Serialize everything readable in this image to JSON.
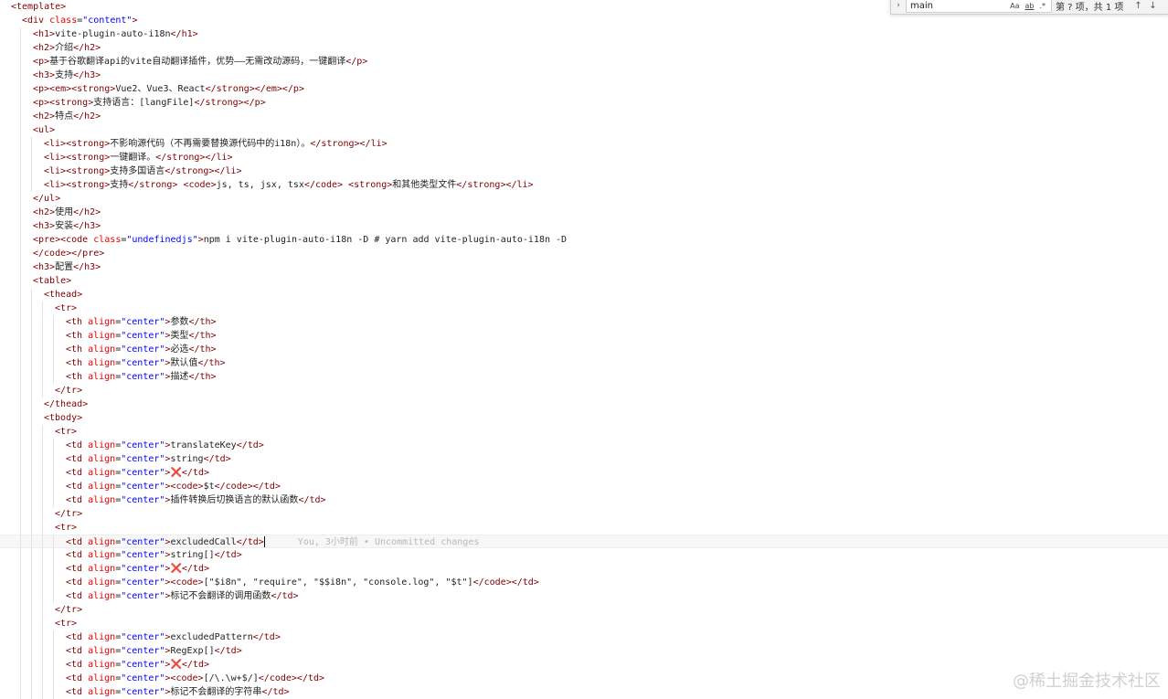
{
  "find_widget": {
    "query": "main",
    "opt_case": "Aa",
    "opt_word": "ab",
    "opt_regex": ".*",
    "result_count": "第 ? 项，共 1 项"
  },
  "blame": "You, 3小时前 • Uncommitted changes",
  "watermark": "@稀土掘金技术社区",
  "lines": [
    {
      "indent": 0,
      "segs": [
        [
          "tag",
          "<template>"
        ]
      ]
    },
    {
      "indent": 1,
      "segs": [
        [
          "tag",
          "<div "
        ],
        [
          "attr",
          "class"
        ],
        [
          "punct",
          "="
        ],
        [
          "str",
          "\"content\""
        ],
        [
          "tag",
          ">"
        ]
      ]
    },
    {
      "indent": 2,
      "segs": [
        [
          "tag",
          "<h1>"
        ],
        [
          "txt",
          "vite-plugin-auto-i18n"
        ],
        [
          "tag",
          "</h1>"
        ]
      ]
    },
    {
      "indent": 2,
      "segs": [
        [
          "tag",
          "<h2>"
        ],
        [
          "txt",
          "介绍"
        ],
        [
          "tag",
          "</h2>"
        ]
      ]
    },
    {
      "indent": 2,
      "segs": [
        [
          "tag",
          "<p>"
        ],
        [
          "txt",
          "基于谷歌翻译api的vite自动翻译插件，优势——无需改动源码，一键翻译"
        ],
        [
          "tag",
          "</p>"
        ]
      ]
    },
    {
      "indent": 2,
      "segs": [
        [
          "tag",
          "<h3>"
        ],
        [
          "txt",
          "支持"
        ],
        [
          "tag",
          "</h3>"
        ]
      ]
    },
    {
      "indent": 2,
      "segs": [
        [
          "tag",
          "<p><em><strong>"
        ],
        [
          "txt",
          "Vue2、Vue3、React"
        ],
        [
          "tag",
          "</strong></em></p>"
        ]
      ]
    },
    {
      "indent": 2,
      "segs": [
        [
          "tag",
          "<p><strong>"
        ],
        [
          "txt",
          "支持语言：[langFile]"
        ],
        [
          "tag",
          "</strong></p>"
        ]
      ]
    },
    {
      "indent": 2,
      "segs": [
        [
          "tag",
          "<h2>"
        ],
        [
          "txt",
          "特点"
        ],
        [
          "tag",
          "</h2>"
        ]
      ]
    },
    {
      "indent": 2,
      "segs": [
        [
          "tag",
          "<ul>"
        ]
      ]
    },
    {
      "indent": 3,
      "segs": [
        [
          "tag",
          "<li><strong>"
        ],
        [
          "txt",
          "不影响源代码（不再需要替换源代码中的i18n）。"
        ],
        [
          "tag",
          "</strong></li>"
        ]
      ]
    },
    {
      "indent": 3,
      "segs": [
        [
          "tag",
          "<li><strong>"
        ],
        [
          "txt",
          "一键翻译。"
        ],
        [
          "tag",
          "</strong></li>"
        ]
      ]
    },
    {
      "indent": 3,
      "segs": [
        [
          "tag",
          "<li><strong>"
        ],
        [
          "txt",
          "支持多国语言"
        ],
        [
          "tag",
          "</strong></li>"
        ]
      ]
    },
    {
      "indent": 3,
      "segs": [
        [
          "tag",
          "<li><strong>"
        ],
        [
          "txt",
          "支持"
        ],
        [
          "tag",
          "</strong>"
        ],
        [
          "txt",
          " "
        ],
        [
          "tag",
          "<code>"
        ],
        [
          "txt",
          "js, ts, jsx, tsx"
        ],
        [
          "tag",
          "</code>"
        ],
        [
          "txt",
          " "
        ],
        [
          "tag",
          "<strong>"
        ],
        [
          "txt",
          "和其他类型文件"
        ],
        [
          "tag",
          "</strong></li>"
        ]
      ]
    },
    {
      "indent": 2,
      "segs": [
        [
          "tag",
          "</ul>"
        ]
      ]
    },
    {
      "indent": 2,
      "segs": [
        [
          "tag",
          "<h2>"
        ],
        [
          "txt",
          "使用"
        ],
        [
          "tag",
          "</h2>"
        ]
      ]
    },
    {
      "indent": 2,
      "segs": [
        [
          "tag",
          "<h3>"
        ],
        [
          "txt",
          "安装"
        ],
        [
          "tag",
          "</h3>"
        ]
      ]
    },
    {
      "indent": 2,
      "segs": [
        [
          "tag",
          "<pre><code "
        ],
        [
          "attr",
          "class"
        ],
        [
          "punct",
          "="
        ],
        [
          "str",
          "\"undefinedjs\""
        ],
        [
          "tag",
          ">"
        ],
        [
          "txt",
          "npm i vite-plugin-auto-i18n -D # yarn add vite-plugin-auto-i18n -D"
        ]
      ]
    },
    {
      "indent": 2,
      "segs": [
        [
          "tag",
          "</code></pre>"
        ]
      ]
    },
    {
      "indent": 2,
      "segs": [
        [
          "tag",
          "<h3>"
        ],
        [
          "txt",
          "配置"
        ],
        [
          "tag",
          "</h3>"
        ]
      ]
    },
    {
      "indent": 2,
      "segs": [
        [
          "tag",
          "<table>"
        ]
      ]
    },
    {
      "indent": 3,
      "segs": [
        [
          "tag",
          "<thead>"
        ]
      ]
    },
    {
      "indent": 4,
      "segs": [
        [
          "tag",
          "<tr>"
        ]
      ]
    },
    {
      "indent": 5,
      "segs": [
        [
          "tag",
          "<th "
        ],
        [
          "attr",
          "align"
        ],
        [
          "punct",
          "="
        ],
        [
          "str",
          "\"center\""
        ],
        [
          "tag",
          ">"
        ],
        [
          "txt",
          "参数"
        ],
        [
          "tag",
          "</th>"
        ]
      ]
    },
    {
      "indent": 5,
      "segs": [
        [
          "tag",
          "<th "
        ],
        [
          "attr",
          "align"
        ],
        [
          "punct",
          "="
        ],
        [
          "str",
          "\"center\""
        ],
        [
          "tag",
          ">"
        ],
        [
          "txt",
          "类型"
        ],
        [
          "tag",
          "</th>"
        ]
      ]
    },
    {
      "indent": 5,
      "segs": [
        [
          "tag",
          "<th "
        ],
        [
          "attr",
          "align"
        ],
        [
          "punct",
          "="
        ],
        [
          "str",
          "\"center\""
        ],
        [
          "tag",
          ">"
        ],
        [
          "txt",
          "必选"
        ],
        [
          "tag",
          "</th>"
        ]
      ]
    },
    {
      "indent": 5,
      "segs": [
        [
          "tag",
          "<th "
        ],
        [
          "attr",
          "align"
        ],
        [
          "punct",
          "="
        ],
        [
          "str",
          "\"center\""
        ],
        [
          "tag",
          ">"
        ],
        [
          "txt",
          "默认值"
        ],
        [
          "tag",
          "</th>"
        ]
      ]
    },
    {
      "indent": 5,
      "segs": [
        [
          "tag",
          "<th "
        ],
        [
          "attr",
          "align"
        ],
        [
          "punct",
          "="
        ],
        [
          "str",
          "\"center\""
        ],
        [
          "tag",
          ">"
        ],
        [
          "txt",
          "描述"
        ],
        [
          "tag",
          "</th>"
        ]
      ]
    },
    {
      "indent": 4,
      "segs": [
        [
          "tag",
          "</tr>"
        ]
      ]
    },
    {
      "indent": 3,
      "segs": [
        [
          "tag",
          "</thead>"
        ]
      ]
    },
    {
      "indent": 3,
      "segs": [
        [
          "tag",
          "<tbody>"
        ]
      ]
    },
    {
      "indent": 4,
      "segs": [
        [
          "tag",
          "<tr>"
        ]
      ]
    },
    {
      "indent": 5,
      "segs": [
        [
          "tag",
          "<td "
        ],
        [
          "attr",
          "align"
        ],
        [
          "punct",
          "="
        ],
        [
          "str",
          "\"center\""
        ],
        [
          "tag",
          ">"
        ],
        [
          "txt",
          "translateKey"
        ],
        [
          "tag",
          "</td>"
        ]
      ]
    },
    {
      "indent": 5,
      "segs": [
        [
          "tag",
          "<td "
        ],
        [
          "attr",
          "align"
        ],
        [
          "punct",
          "="
        ],
        [
          "str",
          "\"center\""
        ],
        [
          "tag",
          ">"
        ],
        [
          "txt",
          "string"
        ],
        [
          "tag",
          "</td>"
        ]
      ]
    },
    {
      "indent": 5,
      "segs": [
        [
          "tag",
          "<td "
        ],
        [
          "attr",
          "align"
        ],
        [
          "punct",
          "="
        ],
        [
          "str",
          "\"center\""
        ],
        [
          "tag",
          ">"
        ],
        [
          "cross",
          "❌"
        ],
        [
          "tag",
          "</td>"
        ]
      ]
    },
    {
      "indent": 5,
      "segs": [
        [
          "tag",
          "<td "
        ],
        [
          "attr",
          "align"
        ],
        [
          "punct",
          "="
        ],
        [
          "str",
          "\"center\""
        ],
        [
          "tag",
          ">"
        ],
        [
          "tag",
          "<code>"
        ],
        [
          "txt",
          "$t"
        ],
        [
          "tag",
          "</code></td>"
        ]
      ]
    },
    {
      "indent": 5,
      "segs": [
        [
          "tag",
          "<td "
        ],
        [
          "attr",
          "align"
        ],
        [
          "punct",
          "="
        ],
        [
          "str",
          "\"center\""
        ],
        [
          "tag",
          ">"
        ],
        [
          "txt",
          "插件转换后切换语言的默认函数"
        ],
        [
          "tag",
          "</td>"
        ]
      ]
    },
    {
      "indent": 4,
      "segs": [
        [
          "tag",
          "</tr>"
        ]
      ]
    },
    {
      "indent": 4,
      "segs": [
        [
          "tag",
          "<tr>"
        ]
      ]
    },
    {
      "indent": 5,
      "current": true,
      "segs": [
        [
          "tag",
          "<td "
        ],
        [
          "attr",
          "align"
        ],
        [
          "punct",
          "="
        ],
        [
          "str",
          "\"center\""
        ],
        [
          "tag",
          ">"
        ],
        [
          "txt",
          "excludedCall"
        ],
        [
          "tag",
          "</td>"
        ]
      ]
    },
    {
      "indent": 5,
      "segs": [
        [
          "tag",
          "<td "
        ],
        [
          "attr",
          "align"
        ],
        [
          "punct",
          "="
        ],
        [
          "str",
          "\"center\""
        ],
        [
          "tag",
          ">"
        ],
        [
          "txt",
          "string[]"
        ],
        [
          "tag",
          "</td>"
        ]
      ]
    },
    {
      "indent": 5,
      "segs": [
        [
          "tag",
          "<td "
        ],
        [
          "attr",
          "align"
        ],
        [
          "punct",
          "="
        ],
        [
          "str",
          "\"center\""
        ],
        [
          "tag",
          ">"
        ],
        [
          "cross",
          "❌"
        ],
        [
          "tag",
          "</td>"
        ]
      ]
    },
    {
      "indent": 5,
      "segs": [
        [
          "tag",
          "<td "
        ],
        [
          "attr",
          "align"
        ],
        [
          "punct",
          "="
        ],
        [
          "str",
          "\"center\""
        ],
        [
          "tag",
          ">"
        ],
        [
          "tag",
          "<code>"
        ],
        [
          "txt",
          "[\"$i8n\", \"require\", \"$$i8n\", \"console.log\", \"$t\"]"
        ],
        [
          "tag",
          "</code></td>"
        ]
      ]
    },
    {
      "indent": 5,
      "segs": [
        [
          "tag",
          "<td "
        ],
        [
          "attr",
          "align"
        ],
        [
          "punct",
          "="
        ],
        [
          "str",
          "\"center\""
        ],
        [
          "tag",
          ">"
        ],
        [
          "txt",
          "标记不会翻译的调用函数"
        ],
        [
          "tag",
          "</td>"
        ]
      ]
    },
    {
      "indent": 4,
      "segs": [
        [
          "tag",
          "</tr>"
        ]
      ]
    },
    {
      "indent": 4,
      "segs": [
        [
          "tag",
          "<tr>"
        ]
      ]
    },
    {
      "indent": 5,
      "segs": [
        [
          "tag",
          "<td "
        ],
        [
          "attr",
          "align"
        ],
        [
          "punct",
          "="
        ],
        [
          "str",
          "\"center\""
        ],
        [
          "tag",
          ">"
        ],
        [
          "txt",
          "excludedPattern"
        ],
        [
          "tag",
          "</td>"
        ]
      ]
    },
    {
      "indent": 5,
      "segs": [
        [
          "tag",
          "<td "
        ],
        [
          "attr",
          "align"
        ],
        [
          "punct",
          "="
        ],
        [
          "str",
          "\"center\""
        ],
        [
          "tag",
          ">"
        ],
        [
          "txt",
          "RegExp[]"
        ],
        [
          "tag",
          "</td>"
        ]
      ]
    },
    {
      "indent": 5,
      "segs": [
        [
          "tag",
          "<td "
        ],
        [
          "attr",
          "align"
        ],
        [
          "punct",
          "="
        ],
        [
          "str",
          "\"center\""
        ],
        [
          "tag",
          ">"
        ],
        [
          "cross",
          "❌"
        ],
        [
          "tag",
          "</td>"
        ]
      ]
    },
    {
      "indent": 5,
      "segs": [
        [
          "tag",
          "<td "
        ],
        [
          "attr",
          "align"
        ],
        [
          "punct",
          "="
        ],
        [
          "str",
          "\"center\""
        ],
        [
          "tag",
          ">"
        ],
        [
          "tag",
          "<code>"
        ],
        [
          "txt",
          "[/\\.\\w+$/]"
        ],
        [
          "tag",
          "</code></td>"
        ]
      ]
    },
    {
      "indent": 5,
      "segs": [
        [
          "tag",
          "<td "
        ],
        [
          "attr",
          "align"
        ],
        [
          "punct",
          "="
        ],
        [
          "str",
          "\"center\""
        ],
        [
          "tag",
          ">"
        ],
        [
          "txt",
          "标记不会翻译的字符串"
        ],
        [
          "tag",
          "</td>"
        ]
      ]
    }
  ]
}
